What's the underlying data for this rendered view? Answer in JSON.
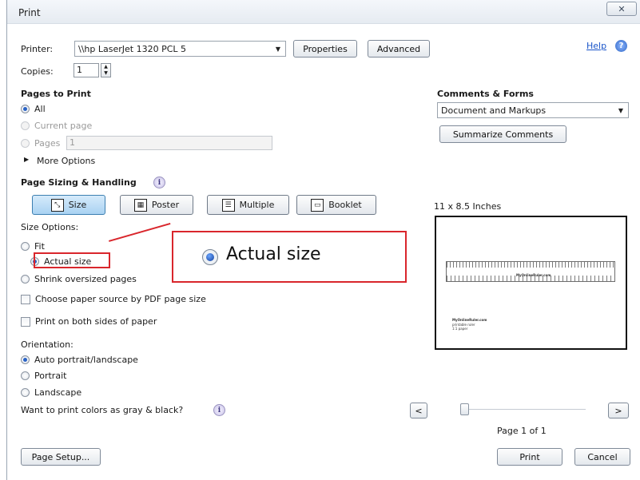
{
  "window": {
    "title": "Print",
    "close_glyph": "✕"
  },
  "header": {
    "printer_label": "Printer:",
    "printer_value": "\\\\hp LaserJet 1320 PCL 5",
    "properties_label": "Properties",
    "advanced_label": "Advanced",
    "help_label": "Help",
    "copies_label": "Copies:",
    "copies_value": "1"
  },
  "pages_to_print": {
    "heading": "Pages to Print",
    "all_label": "All",
    "current_page_label": "Current page",
    "pages_label": "Pages",
    "pages_value": "1",
    "more_options_label": "More Options"
  },
  "comments_forms": {
    "heading": "Comments & Forms",
    "selected": "Document and Markups",
    "summarize_label": "Summarize Comments"
  },
  "sizing": {
    "heading": "Page Sizing & Handling",
    "buttons": [
      {
        "label": "Size",
        "icon": "size-icon",
        "active": true
      },
      {
        "label": "Poster",
        "icon": "poster-icon",
        "active": false
      },
      {
        "label": "Multiple",
        "icon": "multiple-pages-icon",
        "active": false
      },
      {
        "label": "Booklet",
        "icon": "booklet-icon",
        "active": false
      }
    ],
    "size_options_label": "Size Options:",
    "fit_label": "Fit",
    "actual_size_label": "Actual size",
    "shrink_label": "Shrink oversized pages",
    "paper_source_label": "Choose paper source by PDF page size",
    "both_sides_label": "Print on both sides of paper"
  },
  "orientation": {
    "heading": "Orientation:",
    "auto_label": "Auto portrait/landscape",
    "portrait_label": "Portrait",
    "landscape_label": "Landscape",
    "gray_question": "Want to print colors as gray & black?"
  },
  "preview": {
    "size_label": "11 x 8.5 Inches",
    "ruler_title": "MyOnlineRuler.com",
    "footer_line1": "MyOnlineRuler.com",
    "footer_line2": "printable ruler",
    "footer_line3": "1:1 paper",
    "page_indicator": "Page 1 of 1",
    "prev_label": "<",
    "next_label": ">"
  },
  "callout": {
    "label": "Actual size"
  },
  "footer": {
    "page_setup_label": "Page Setup...",
    "print_label": "Print",
    "cancel_label": "Cancel"
  },
  "colors": {
    "callout": "#d9262c",
    "active_button": "#a9d2f2",
    "link": "#1a55c9"
  }
}
